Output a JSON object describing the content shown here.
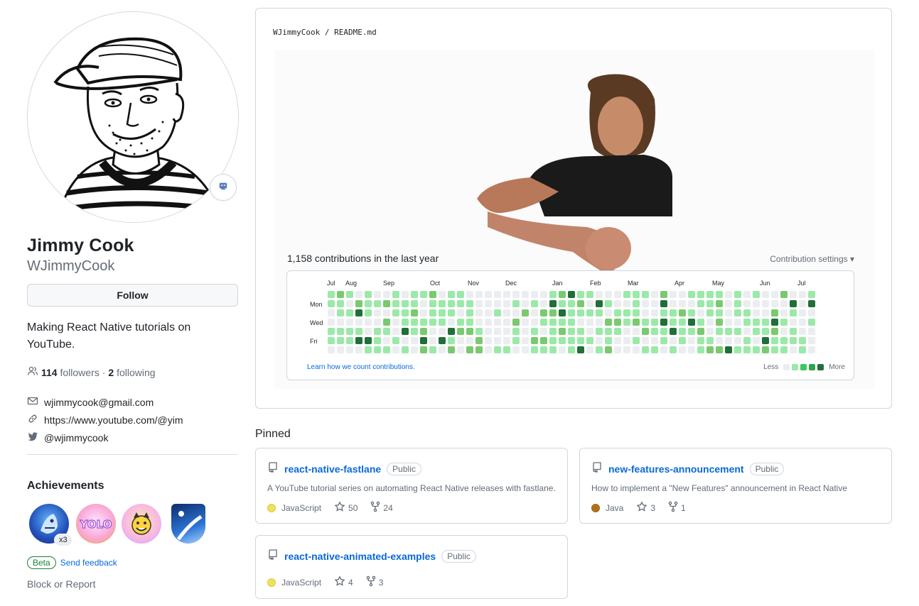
{
  "profile": {
    "fullname": "Jimmy Cook",
    "username": "WJimmyCook",
    "follow_label": "Follow",
    "bio": "Making React Native tutorials on YouTube.",
    "followers_count": "114",
    "followers_label": "followers",
    "dot": "·",
    "following_count": "2",
    "following_label": "following",
    "email": "wjimmycook@gmail.com",
    "website": "https://www.youtube.com/@yim",
    "twitter": "@wjimmycook"
  },
  "achievements": {
    "title": "Achievements",
    "badge_count": "x3",
    "badges": [
      "pull-shark-badge",
      "yolo-badge",
      "starstruck-badge",
      "arctic-code-vault-badge"
    ],
    "beta_label": "Beta",
    "feedback_label": "Send feedback",
    "block_label": "Block or Report"
  },
  "readme": {
    "owner": "WJimmyCook",
    "separator": "/",
    "file": "README.md",
    "contrib_title": "1,158 contributions in the last year",
    "contrib_settings": "Contribution settings ▾",
    "months": [
      "Jul",
      "Aug",
      "Sep",
      "Oct",
      "Nov",
      "Dec",
      "Jan",
      "Feb",
      "Mar",
      "Apr",
      "May",
      "Jun",
      "Jul"
    ],
    "days": [
      "Mon",
      "Wed",
      "Fri"
    ],
    "learn_link": "Learn how we count contributions.",
    "legend_less": "Less",
    "legend_more": "More",
    "colors": {
      "empty": "#ebedf0",
      "l1": "#9be9a8",
      "l2": "#7bc96f",
      "l3": "#40c463",
      "l4": "#216e39"
    }
  },
  "pinned": {
    "title": "Pinned",
    "repos": [
      {
        "name": "react-native-fastlane",
        "visibility": "Public",
        "description": "A YouTube tutorial series on automating React Native releases with fastlane.",
        "language": "JavaScript",
        "lang_color": "#f1e05a",
        "stars": "50",
        "forks": "24"
      },
      {
        "name": "new-features-announcement",
        "visibility": "Public",
        "description": "How to implement a \"New Features\" announcement in React Native",
        "language": "Java",
        "lang_color": "#b07219",
        "stars": "3",
        "forks": "1"
      },
      {
        "name": "react-native-animated-examples",
        "visibility": "Public",
        "description": "",
        "language": "JavaScript",
        "lang_color": "#f1e05a",
        "stars": "4",
        "forks": "3"
      }
    ]
  }
}
